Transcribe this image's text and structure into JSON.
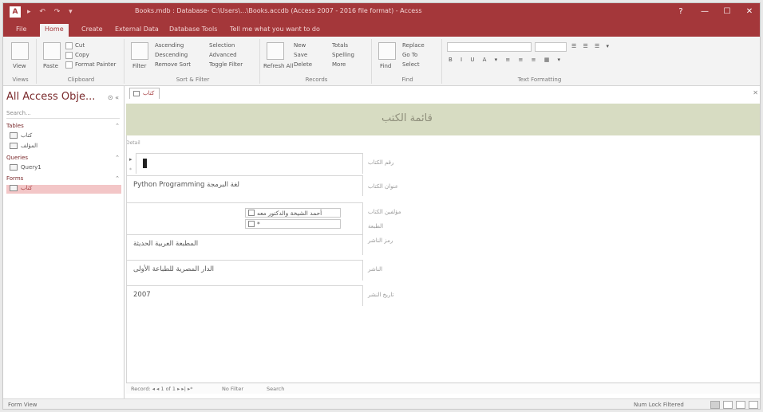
{
  "window": {
    "app_badge": "A",
    "qat": "▸ ↶ ↷ ▾",
    "title": "Books.mdb : Database- C:\\Users\\...\\Books.accdb (Access 2007 - 2016 file format) - Access",
    "controls": {
      "minimize": "—",
      "maximize": "☐",
      "close": "✕",
      "help": "?"
    }
  },
  "ribbon_tabs": [
    {
      "label": "File",
      "active": false
    },
    {
      "label": "Home",
      "active": true
    },
    {
      "label": "Create",
      "active": false
    },
    {
      "label": "External Data",
      "active": false
    },
    {
      "label": "Database Tools",
      "active": false
    },
    {
      "label": "Tell me what you want to do",
      "active": false
    }
  ],
  "ribbon": {
    "views": {
      "label": "View",
      "group": "Views"
    },
    "clipboard": {
      "paste": "Paste",
      "cut": "Cut",
      "copy": "Copy",
      "format_painter": "Format Painter",
      "group": "Clipboard"
    },
    "sort_filter": {
      "filter": "Filter",
      "ascending": "Ascending",
      "descending": "Descending",
      "remove_sort": "Remove Sort",
      "selection": "Selection",
      "advanced": "Advanced",
      "toggle_filter": "Toggle Filter",
      "group": "Sort & Filter"
    },
    "records": {
      "refresh": "Refresh All",
      "new": "New",
      "save": "Save",
      "delete": "Delete",
      "totals": "Totals",
      "spelling": "Spelling",
      "more": "More",
      "group": "Records"
    },
    "find": {
      "find": "Find",
      "replace": "Replace",
      "goto": "Go To",
      "select": "Select",
      "group": "Find"
    },
    "text_formatting": {
      "group": "Text Formatting"
    }
  },
  "nav_pane": {
    "title": "All Access Obje...",
    "controls": "⊙ «",
    "search_placeholder": "Search...",
    "sections": [
      {
        "label": "Tables",
        "chevron": "⌃",
        "items": [
          "كتاب",
          "المؤلف"
        ]
      },
      {
        "label": "Queries",
        "chevron": "⌃",
        "items": [
          "Query1"
        ]
      },
      {
        "label": "Forms",
        "chevron": "⌃",
        "items": [
          "كتاب"
        ]
      }
    ]
  },
  "document": {
    "tab_label": "كتاب",
    "close": "✕",
    "form_title": "قائمة الكتب",
    "detail_label": "Detail",
    "record_selector": "▸",
    "record_selector2": "*",
    "fields": [
      {
        "label": "رقم الكتاب",
        "value": ""
      },
      {
        "label": "عنوان الكتاب",
        "value": "Python Programming  لغة البرمجة"
      },
      {
        "label": "مؤلفين الكتاب",
        "value": ""
      },
      {
        "label": "الطبعة",
        "value": ""
      },
      {
        "label": "رمز الناشر",
        "value": "المطبعة العربية الحديثة"
      },
      {
        "label": "الناشر",
        "value": "الدار المصرية للطباعة الأولى"
      },
      {
        "label": "تاريخ النشر",
        "value": "2007"
      }
    ],
    "subform_rows": [
      {
        "text": "أحمد الشيخة والدكتور معه"
      },
      {
        "text": "*"
      }
    ],
    "record_nav": {
      "label": "Record: ◂  ◂  1 of 1  ▸  ▸|  ▸*",
      "filter": "No Filter",
      "search": "Search"
    }
  },
  "status_bar": {
    "left": "Form View",
    "right": "Num Lock   Filtered",
    "views": [
      "form-view",
      "datasheet-view",
      "layout-view",
      "design-view"
    ]
  }
}
